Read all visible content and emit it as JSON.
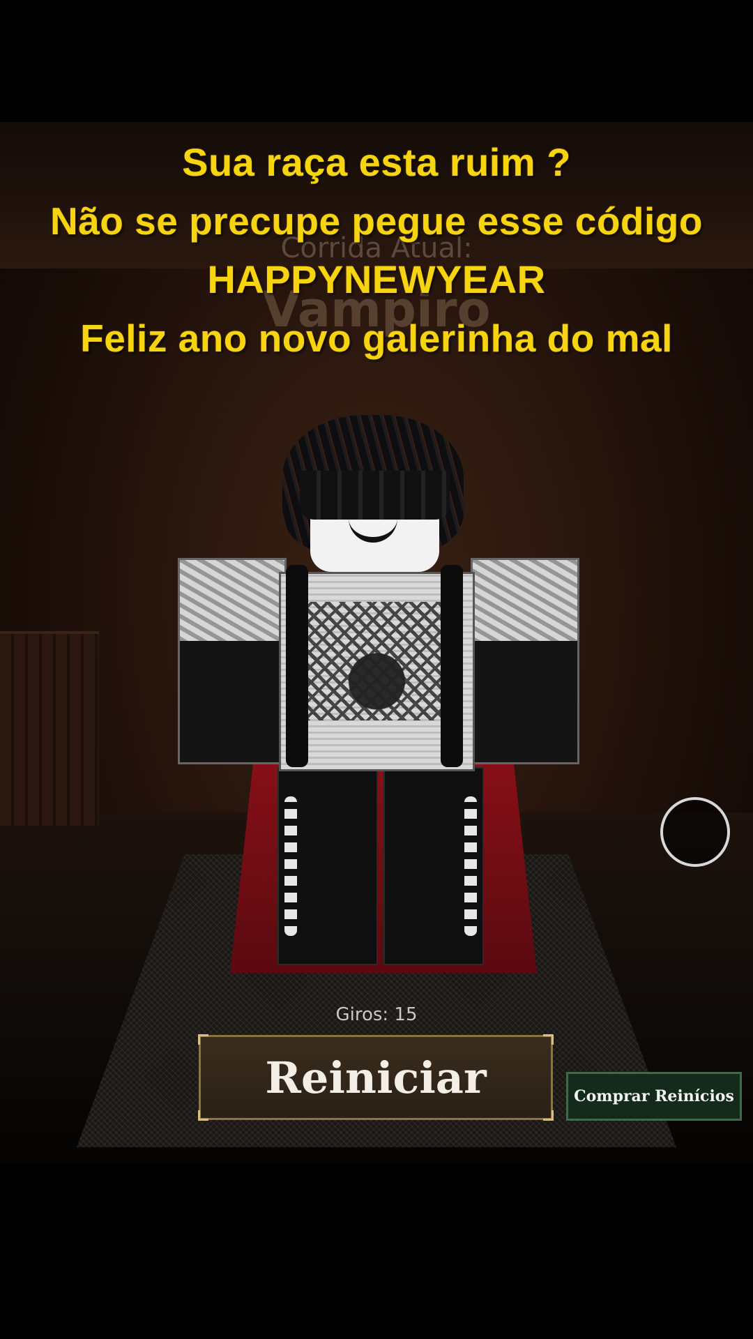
{
  "overlay_caption": {
    "line1": "Sua raça esta ruim ?",
    "line2": "Não se precupe pegue esse código",
    "line3": "HAPPYNEWYEAR",
    "line4": "Feliz ano novo galerinha do mal"
  },
  "race_panel": {
    "label": "Corrida Atual:",
    "race": "Vampiro"
  },
  "spins": {
    "text": "Giros: 15"
  },
  "buttons": {
    "reset_label": "Reiniciar",
    "buy_label": "Comprar Reinícios"
  },
  "colors": {
    "caption": "#f6d40f",
    "reset_border": "#8a7444",
    "buy_background": "#142a1c"
  }
}
